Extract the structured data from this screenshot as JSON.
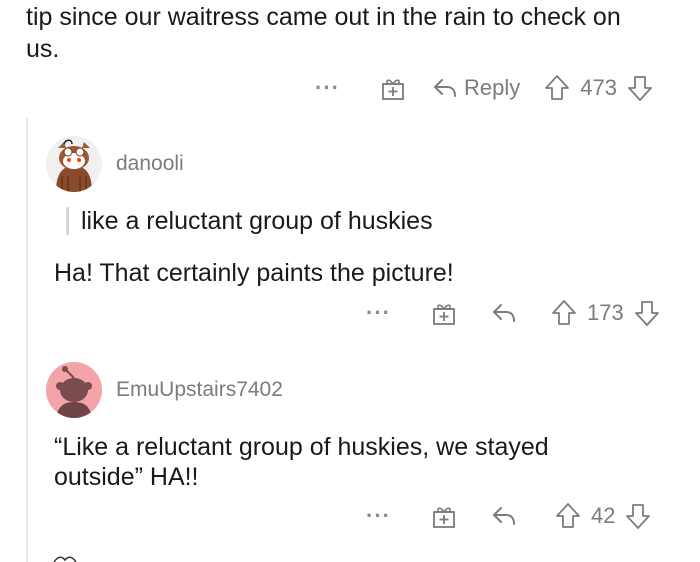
{
  "top_comment": {
    "text_line1": "tip since our waitress came out in the rain to check on",
    "text_line2": "us.",
    "actions": {
      "more": "···",
      "reply_label": "Reply",
      "score": "473"
    }
  },
  "replies": [
    {
      "username": "danooli",
      "avatar_icon": "snoo-avatar-icon",
      "quote": "like a reluctant group of huskies",
      "text": "Ha! That certainly paints the picture!",
      "actions": {
        "more": "···",
        "score": "173"
      }
    },
    {
      "username": "EmuUpstairs7402",
      "avatar_icon": "snoo-avatar-icon",
      "text_line1": "“Like a reluctant group of huskies, we stayed",
      "text_line2": "outside” HA!!",
      "actions": {
        "more": "···",
        "score": "42"
      }
    }
  ],
  "colors": {
    "meta_gray": "#7c7c7c",
    "avatar2_bg": "#f4a3a8",
    "thread_line": "#e6e6e6"
  }
}
